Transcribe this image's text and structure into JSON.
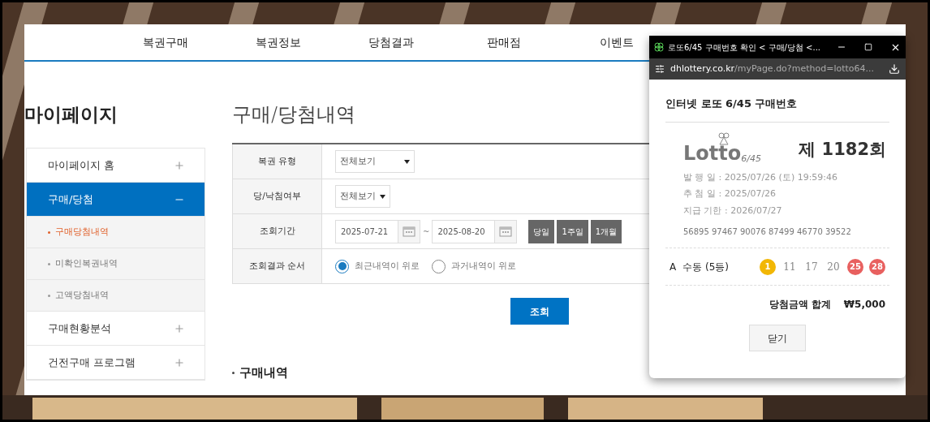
{
  "nav": [
    "복권구매",
    "복권정보",
    "당첨결과",
    "판매점",
    "이벤트"
  ],
  "sidebar": {
    "title": "마이페이지",
    "items": [
      {
        "label": "마이페이지 홈",
        "expanded": false,
        "selected": false
      },
      {
        "label": "구매/당첨",
        "expanded": true,
        "selected": true,
        "children": [
          {
            "label": "구매당첨내역",
            "selected": true
          },
          {
            "label": "미확인복권내역",
            "selected": false
          },
          {
            "label": "고액당첨내역",
            "selected": false
          }
        ]
      },
      {
        "label": "구매현황분석",
        "expanded": false,
        "selected": false
      },
      {
        "label": "건전구매 프로그램",
        "expanded": false,
        "selected": false
      }
    ]
  },
  "page_title": "구매/당첨내역",
  "form": [
    {
      "kind": "select",
      "label": "복권 유형",
      "value": "전체보기"
    },
    {
      "kind": "select",
      "label": "당/낙첨여부",
      "value": "전체보기"
    },
    {
      "kind": "date_range",
      "label": "조회기간",
      "from": "2025-07-21",
      "separator": "~",
      "to": "2025-08-20",
      "presets": [
        "당일",
        "1주일",
        "1개월"
      ]
    },
    {
      "kind": "radio",
      "label": "조회결과 순서",
      "options": [
        {
          "label": "최근내역이 위로",
          "selected": true
        },
        {
          "label": "과거내역이 위로",
          "selected": false
        }
      ]
    }
  ],
  "search_button": "조회",
  "section_title": "구매내역",
  "popup": {
    "window_title": "로또6/45 구매번호 확인 < 구매/당첨 <...",
    "url_host": "dhlottery.co.kr",
    "url_path": "/myPage.do?method=lotto64...",
    "heading": "인터넷 로또 6/45 구매번호",
    "logo_word": "Lotto",
    "logo_sub": "6/45",
    "round": "제 1182회",
    "details": [
      "발 행 일 : 2025/07/26 (토) 19:59:46",
      "추 첨 일 : 2025/07/26",
      "지급 기한 : 2026/07/27"
    ],
    "barcode": "56895 97467 90076 87499 46770 39522",
    "game": {
      "slot": "A",
      "mode": "수동 (5등)",
      "numbers": [
        {
          "value": "1",
          "matched": true,
          "color": "#f2b705"
        },
        {
          "value": "11",
          "matched": false
        },
        {
          "value": "17",
          "matched": false
        },
        {
          "value": "20",
          "matched": false
        },
        {
          "value": "25",
          "matched": true,
          "color": "#e8605f"
        },
        {
          "value": "28",
          "matched": true,
          "color": "#e8605f"
        }
      ]
    },
    "total_label": "당첨금액 합계",
    "total": "₩5,000",
    "close_button": "닫기"
  }
}
